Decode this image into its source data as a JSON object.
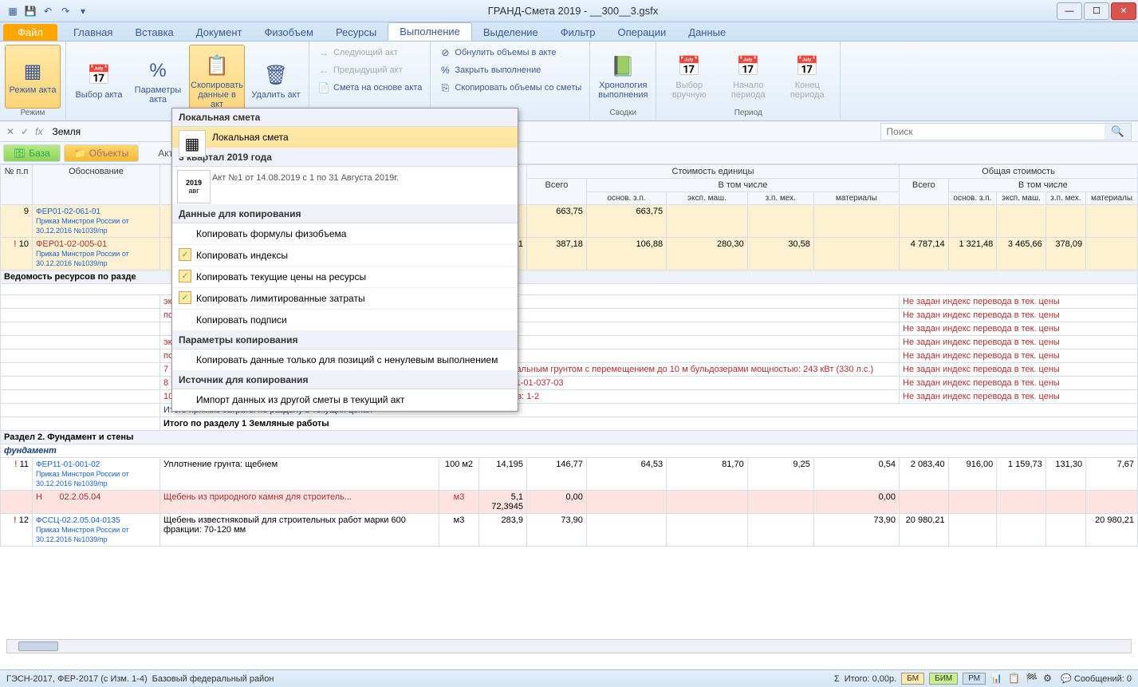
{
  "title": "ГРАНД-Смета 2019 - __300__3.gsfx",
  "ribbon": {
    "file": "Файл",
    "tabs": [
      "Главная",
      "Вставка",
      "Документ",
      "Физобъем",
      "Ресурсы",
      "Выполнение",
      "Выделение",
      "Фильтр",
      "Операции",
      "Данные"
    ],
    "active_tab": "Выполнение",
    "groups": {
      "rezhim": {
        "label": "Режим",
        "btn": "Режим акта"
      },
      "akt": {
        "label": "Акт",
        "vybor": "Выбор акта",
        "param": "Параметры акта",
        "copy": "Скопировать данные в акт",
        "delete": "Удалить акт"
      },
      "small": {
        "next": "Следующий акт",
        "prev": "Предыдущий акт",
        "smeta": "Смета на основе акта"
      },
      "vol": {
        "reset": "Обнулить объемы в акте",
        "close": "Закрыть выполнение",
        "copyv": "Скопировать объемы со сметы"
      },
      "hron": {
        "label": "Сводки",
        "btn": "Хронология выполнения"
      },
      "period": {
        "label": "Период",
        "manual": "Выбор вручную",
        "start": "Начало периода",
        "end": "Конец периода"
      }
    }
  },
  "formula": {
    "fx": "fx",
    "text": "Земля"
  },
  "search": {
    "placeholder": "Поиск"
  },
  "nav": {
    "baza": "База",
    "objects": "Объекты",
    "act_label": "Акт N"
  },
  "dropdown": {
    "s1_hdr": "Локальная смета",
    "s1_item": "Локальная смета",
    "s2_hdr": "3 квартал 2019 года",
    "s2_year": "2019",
    "s2_month": "авг",
    "s2_text": "Акт №1 от 14.08.2019 с 1 по 31 Августа 2019г.",
    "s3_hdr": "Данные для копирования",
    "s3_items": [
      {
        "label": "Копировать формулы физобъема",
        "checked": false
      },
      {
        "label": "Копировать индексы",
        "checked": true
      },
      {
        "label": "Копировать текущие цены на ресурсы",
        "checked": true
      },
      {
        "label": "Копировать лимитированные затраты",
        "checked": true
      },
      {
        "label": "Копировать подписи",
        "checked": false
      }
    ],
    "s4_hdr": "Параметры копирования",
    "s4_item": "Копировать данные только для позиций с ненулевым выполнением",
    "s5_hdr": "Источник для копирования",
    "s5_item": "Импорт данных из другой сметы в текущий акт"
  },
  "headers": {
    "num": "№ п.п",
    "osn": "Обоснование",
    "cost_unit": "Стоимость единицы",
    "cost_total": "Общая стоимость",
    "vsego": "Всего",
    "vtom": "В том числе",
    "sub": [
      "основ. з.п.",
      "эксп. маш.",
      "з.п. мех.",
      "материалы"
    ]
  },
  "rows": {
    "r9": {
      "num": "9",
      "code": "ФЕР01-02-061-01",
      "order": "Приказ Минстроя России от 30.12.2016 №1039/пр",
      "vsego": "663,75",
      "ozp": "663,75"
    },
    "r10": {
      "num": "10",
      "code": "ФЕР01-02-005-01",
      "order": "Приказ Минстроя России от 30.12.2016 №1039/пр",
      "qty": "411",
      "vsego": "387,18",
      "ozp": "106,88",
      "em": "280,30",
      "zpm": "30,58",
      "t_vsego": "4 787,14",
      "t_ozp": "1 321,48",
      "t_em": "3 465,66",
      "t_zpm": "378,09"
    },
    "vedomost": "Ведомость ресурсов по разде",
    "no_index": "Не задан индекс перевода в тек. цены",
    "items": [
      "экскаваторами с ковшом вместимостью: 1,6 (1,25-1,6) м3,",
      "подъемностью 10 т работающих вне карьера на расстояние:",
      "",
      "экскаваторами с ковшом вместимостью: 0,5 (0,5-0,63) м3,",
      "подъемностью 10 т работающих вне карьера на расстояние:"
    ],
    "item7": "7 ФЕР01-01-037-03 Засыпка траншей и котлованов предварительно разрыхленным скальным грунтом с перемещением до 10 м бульдозерами мощностью: 243 кВт (330 л.с.)",
    "item8": "8 ФЕР01-01-037-06 При перемещении грунта на каждые 10 м добавлять: к расценке 01-01-037-03",
    "item10": "10 ФЕР01-02-005-01 Уплотнение грунта пневматическими трамбовками, группа грунтов: 1-2",
    "total_cur": "Итого прямые затраты по разделу в текущих ценах",
    "total_sec": "Итого по разделу 1 Земляные работы",
    "sec2": "Раздел 2. Фундамент и стены",
    "fund": "фундамент",
    "r11": {
      "num": "11",
      "code": "ФЕР11-01-001-02",
      "order": "Приказ Минстроя России от 30.12.2016 №1039/пр",
      "desc": "Уплотнение грунта: щебнем",
      "unit": "100 м2",
      "qty": "14,195",
      "vsego": "146,77",
      "ozp": "64,53",
      "em": "81,70",
      "zpm": "9,25",
      "mat": "0,54",
      "t_vsego": "2 083,40",
      "t_ozp": "916,00",
      "t_em": "1 159,73",
      "t_zpm": "131,30",
      "t_mat": "7,67"
    },
    "rn": {
      "code": "Н",
      "id": "02.2.05.04",
      "desc": "Щебень из природного камня для строитель...",
      "unit": "м3",
      "q1": "5,1",
      "q2": "72,3945",
      "v": "0,00",
      "t": "0,00"
    },
    "r12": {
      "num": "12",
      "code": "ФССЦ-02.2.05.04-0135",
      "order": "Приказ Минстроя России от 30.12.2016 №1039/пр",
      "desc": "Щебень известняковый для строительных работ марки 600 фракции: 70-120 мм",
      "unit": "м3",
      "qty": "283,9",
      "vsego": "73,90",
      "t_mat_a": "73,90",
      "t_vsego": "20 980,21",
      "t_mat": "20 980,21"
    }
  },
  "status": {
    "left1": "ГЭСН-2017, ФЕР-2017 (с Изм. 1-4)",
    "left2": "Базовый федеральный район",
    "total": "Итого: 0,00р.",
    "bm": "БМ",
    "bim": "БИМ",
    "rm": "РМ",
    "msgs": "Сообщений: 0"
  }
}
